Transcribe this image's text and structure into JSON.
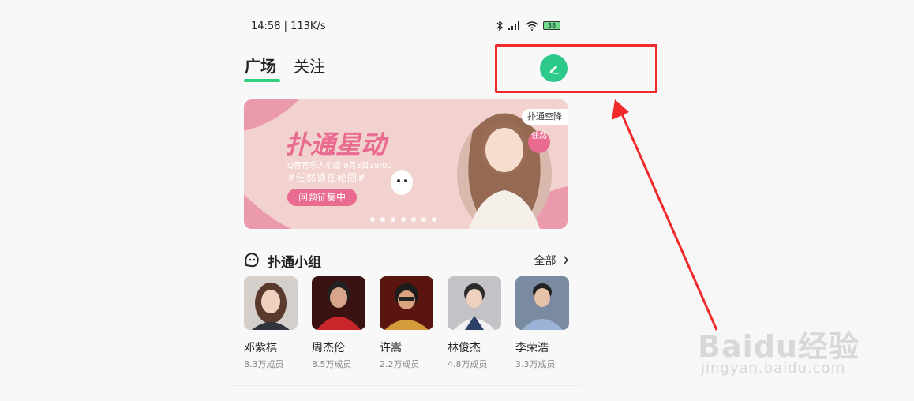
{
  "statusbar": {
    "time": "14:58 | 113K/s",
    "battery": "38"
  },
  "tabs": [
    {
      "label": "广场",
      "active": true
    },
    {
      "label": "关注",
      "active": false
    }
  ],
  "banner": {
    "title": "扑通星动",
    "subtitle": "Q音音乐人小组  9月3日18:00",
    "tag": "#任然锁在轮回#",
    "button": "问题征集中",
    "badge": "扑通空降",
    "circle": "任然"
  },
  "section": {
    "title": "扑通小组",
    "more": "全部"
  },
  "artists": [
    {
      "name": "邓紫棋",
      "count": "8.3万成员",
      "color": "#c9c2bd"
    },
    {
      "name": "周杰伦",
      "count": "8.5万成员",
      "color": "#b8262c"
    },
    {
      "name": "许嵩",
      "count": "2.2万成员",
      "color": "#8a1f1c"
    },
    {
      "name": "林俊杰",
      "count": "4.8万成员",
      "color": "#b9b7b9"
    },
    {
      "name": "李荣浩",
      "count": "3.3万成员",
      "color": "#6c7f99"
    }
  ],
  "watermark": {
    "brand": "Baidu经验",
    "url": "jingyan.baidu.com"
  },
  "colors": {
    "accent": "#2fd17f",
    "edit_button": "#2cc98a",
    "annotation": "#f02a2a",
    "banner_pink": "#e96b8f"
  },
  "icons": {
    "edit": "pencil-icon",
    "bluetooth": "bluetooth-icon",
    "signal": "signal-icon",
    "wifi": "wifi-icon",
    "group": "group-face-icon",
    "chevron": "chevron-right-icon"
  }
}
